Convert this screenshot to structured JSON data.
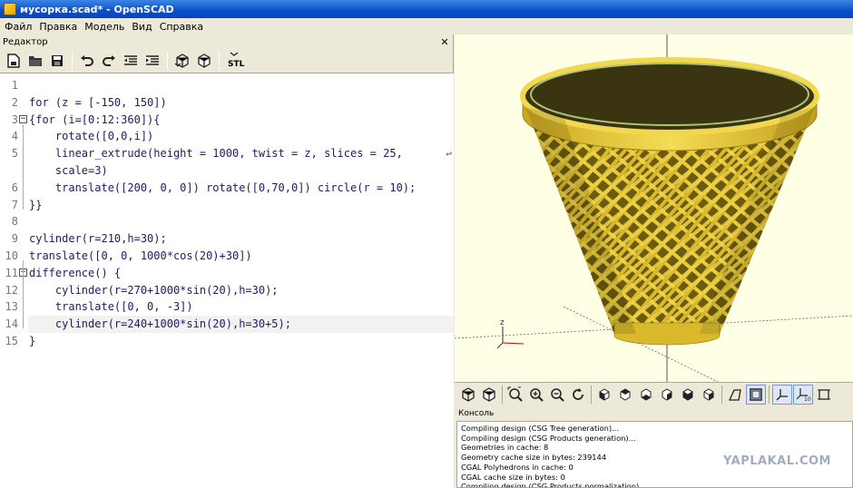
{
  "window": {
    "title": "мусорка.scad* - OpenSCAD"
  },
  "menu": [
    "Файл",
    "Правка",
    "Модель",
    "Вид",
    "Справка"
  ],
  "editor": {
    "panel_title": "Редактор",
    "toolbar_icons": [
      "new-file-icon",
      "open-file-icon",
      "save-icon",
      "undo-icon",
      "redo-icon",
      "unindent-icon",
      "indent-icon",
      "preview-icon",
      "render-icon",
      "export-stl-icon"
    ],
    "stl_label": "STL",
    "lines": [
      {
        "num": "1",
        "text": ""
      },
      {
        "num": "2",
        "text": "for (z = [-150, 150])"
      },
      {
        "num": "3",
        "text": "{for (i=[0:12:360]){",
        "fold": true
      },
      {
        "num": "4",
        "text": "    rotate([0,0,i])"
      },
      {
        "num": "5",
        "text": "    linear_extrude(height = 1000, twist = z, slices = 25,",
        "wrap": true
      },
      {
        "num": "",
        "text": "    scale=3)"
      },
      {
        "num": "6",
        "text": "    translate([200, 0, 0]) rotate([0,70,0]) circle(r = 10);"
      },
      {
        "num": "7",
        "text": "}}"
      },
      {
        "num": "8",
        "text": ""
      },
      {
        "num": "9",
        "text": "cylinder(r=210,h=30);"
      },
      {
        "num": "10",
        "text": "translate([0, 0, 1000*cos(20)+30])"
      },
      {
        "num": "11",
        "text": "difference() {",
        "fold": true
      },
      {
        "num": "12",
        "text": "    cylinder(r=270+1000*sin(20),h=30);"
      },
      {
        "num": "13",
        "text": "    translate([0, 0, -3])"
      },
      {
        "num": "14",
        "text": "    cylinder(r=240+1000*sin(20),h=30+5);",
        "current": true
      },
      {
        "num": "15",
        "text": "}"
      }
    ]
  },
  "viewport": {
    "axis_label_z": "z",
    "model_color": "#e8cc3a",
    "background_color": "#ffffe6"
  },
  "view_toolbar_icons": [
    "preview-icon",
    "render-icon",
    "zoom-all-icon",
    "zoom-in-icon",
    "zoom-out-icon",
    "reset-view-icon",
    "view-right-icon",
    "view-top-icon",
    "view-bottom-icon",
    "view-left-icon",
    "view-front-icon",
    "view-back-icon",
    "perspective-icon",
    "orthogonal-icon",
    "show-axes-icon",
    "show-scale-icon",
    "show-edges-icon"
  ],
  "console": {
    "title": "Консоль",
    "lines": [
      "Compiling design (CSG Tree generation)...",
      "Compiling design (CSG Products generation)...",
      "Geometries in cache: 8",
      "Geometry cache size in bytes: 239144",
      "CGAL Polyhedrons in cache: 0",
      "CGAL cache size in bytes: 0",
      "Compiling design (CSG Products normalization)..."
    ]
  },
  "watermark": "YAPLAKAL.COM"
}
